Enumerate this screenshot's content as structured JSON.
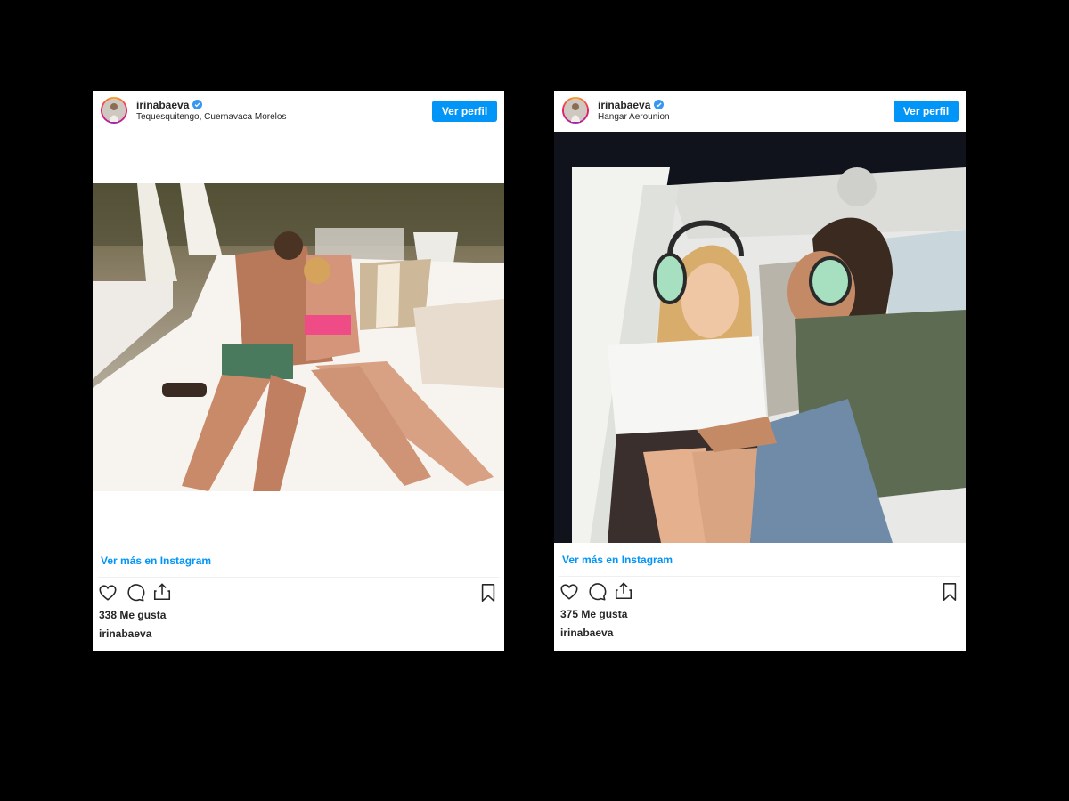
{
  "posts": [
    {
      "username": "irinabaeva",
      "location": "Tequesquitengo, Cuernavaca Morelos",
      "profile_button": "Ver perfil",
      "view_more": "Ver más en Instagram",
      "likes": "338 Me gusta",
      "caption_user": "irinabaeva",
      "photo": "couple-on-white-sunbed"
    },
    {
      "username": "irinabaeva",
      "location": "Hangar Aerounion",
      "profile_button": "Ver perfil",
      "view_more": "Ver más en Instagram",
      "likes": "375 Me gusta",
      "caption_user": "irinabaeva",
      "photo": "couple-in-helicopter-with-headsets"
    }
  ],
  "icons": [
    "heart-icon",
    "comment-icon",
    "share-icon",
    "bookmark-icon",
    "verified-icon"
  ],
  "colors": {
    "accent": "#0095f6",
    "text": "#262626",
    "background": "#000000"
  }
}
